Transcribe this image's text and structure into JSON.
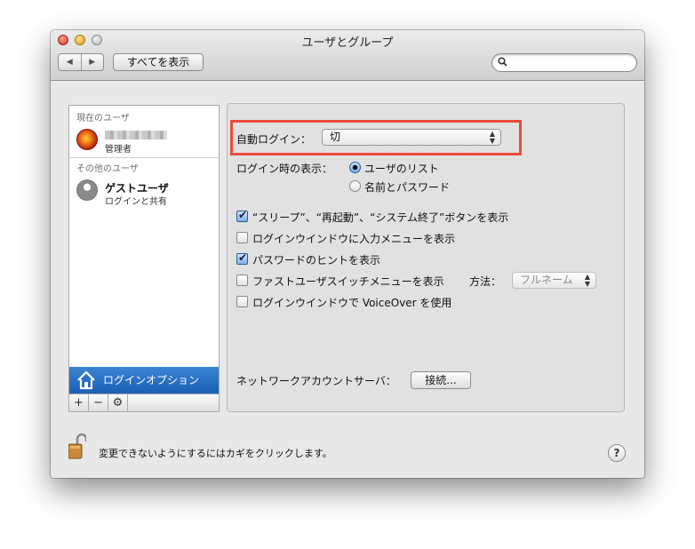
{
  "window": {
    "title": "ユーザとグループ"
  },
  "toolbar": {
    "back_icon": "◀",
    "forward_icon": "▶",
    "show_all_label": "すべてを表示",
    "search_placeholder": ""
  },
  "sidebar": {
    "current_users_header": "現在のユーザ",
    "current_user": {
      "name": "",
      "role": "管理者"
    },
    "other_users_header": "その他のユーザ",
    "guest": {
      "name": "ゲストユーザ",
      "sub": "ログインと共有"
    },
    "login_options_label": "ログインオプション",
    "add_label": "+",
    "remove_label": "−",
    "gear_label": "⚙"
  },
  "main": {
    "auto_login": {
      "label": "自動ログイン：",
      "value": "切"
    },
    "login_window": {
      "label": "ログイン時の表示：",
      "option_list": "ユーザのリスト",
      "option_name": "名前とパスワード",
      "selected": "list"
    },
    "checkboxes": [
      {
        "label": "“スリープ”、“再起動”、“システム終了”ボタンを表示",
        "checked": true
      },
      {
        "label": "ログインウインドウに入力メニューを表示",
        "checked": false
      },
      {
        "label": "パスワードのヒントを表示",
        "checked": true
      },
      {
        "label": "ファストユーザスイッチメニューを表示",
        "checked": false
      },
      {
        "label": "ログインウインドウで VoiceOver を使用",
        "checked": false
      }
    ],
    "fast_switch_method": {
      "label": "方法：",
      "value": "フルネーム"
    },
    "network_server": {
      "label": "ネットワークアカウントサーバ：",
      "button": "接続..."
    }
  },
  "footer": {
    "lock_text": "変更できないようにするにはカギをクリックします。",
    "help_label": "?"
  },
  "colors": {
    "highlight": "#e94b3c",
    "selection": "#1a5fb3",
    "window_bg": "#e8e8e8"
  }
}
